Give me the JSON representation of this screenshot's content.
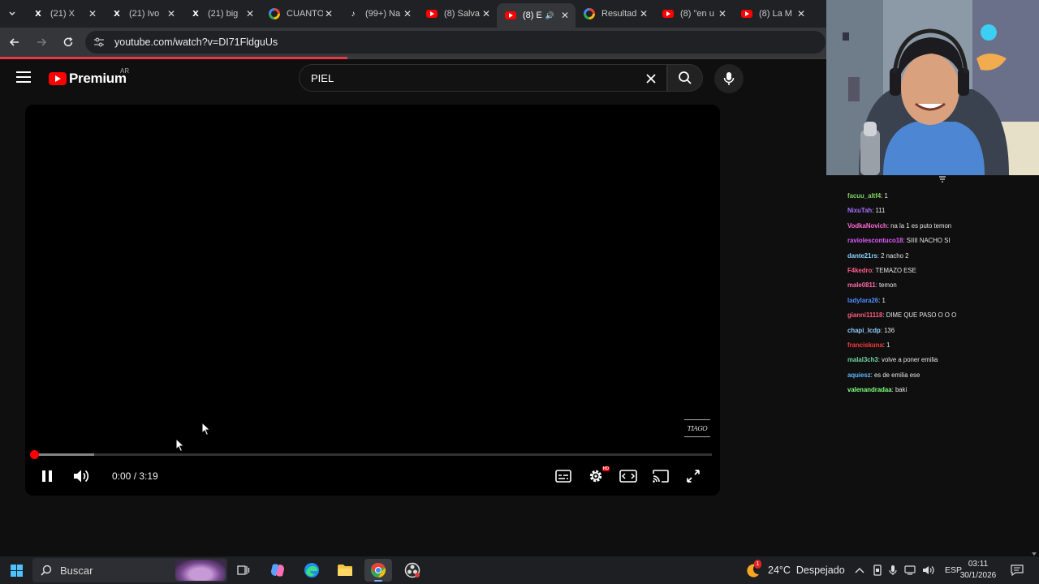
{
  "browser": {
    "tabs": [
      {
        "title": "(21) X",
        "icon": "x-logo-icon",
        "active": false
      },
      {
        "title": "(21) Ivo",
        "icon": "x-logo-icon",
        "active": false
      },
      {
        "title": "(21) big",
        "icon": "x-logo-icon",
        "active": false
      },
      {
        "title": "CUANTO",
        "icon": "google-icon",
        "active": false
      },
      {
        "title": "(99+) Na",
        "icon": "tiktok-icon",
        "active": false
      },
      {
        "title": "(8) Salva",
        "icon": "youtube-icon",
        "active": false
      },
      {
        "title": "(8) E",
        "icon": "youtube-icon",
        "active": true,
        "audio": true
      },
      {
        "title": "Resultad",
        "icon": "google-icon",
        "active": false
      },
      {
        "title": "(8) \"en u",
        "icon": "youtube-icon",
        "active": false
      },
      {
        "title": "(8) La M",
        "icon": "youtube-icon",
        "active": false
      }
    ],
    "url": "youtube.com/watch?v=DI71FldguUs",
    "load_progress_percent": 42
  },
  "youtube": {
    "logo_text": "Premium",
    "country_code": "AR",
    "search_query": "PIEL"
  },
  "player": {
    "watermark": "TIAGO",
    "current_time": "0:00",
    "separator": " / ",
    "duration": "3:19",
    "buffered_percent": 9,
    "played_percent": 0,
    "hd_badge": "HD"
  },
  "chat": {
    "messages": [
      {
        "user": "facuu_altf4",
        "color": "#7fd35f",
        "text": ": 1"
      },
      {
        "user": "NixuTah",
        "color": "#a970ff",
        "text": ": 111"
      },
      {
        "user": "VodkaNovich",
        "color": "#ff6ad5",
        "text": ": na la 1 es puto temon"
      },
      {
        "user": "raviolescontuco18",
        "color": "#e05cff",
        "text": ": SIIII NACHO SI"
      },
      {
        "user": "dante21rs",
        "color": "#8fd0ff",
        "text": ": 2 nacho 2"
      },
      {
        "user": "F4kedro",
        "color": "#ff5c8a",
        "text": ": TEMAZO ESE"
      },
      {
        "user": "male0811",
        "color": "#ff6aa8",
        "text": ": temon"
      },
      {
        "user": "ladylara26",
        "color": "#4f8cff",
        "text": ": 1"
      },
      {
        "user": "gianni11118",
        "color": "#ff5c7a",
        "text": ": DIME QUE PASO O O O"
      },
      {
        "user": "chapi_lcdp",
        "color": "#8fd0ff",
        "text": ": 136"
      },
      {
        "user": "franciskuna",
        "color": "#ff3b3b",
        "text": ": 1"
      },
      {
        "user": "malal3ch3",
        "color": "#6fd4a0",
        "text": ": volve a poner emilia"
      },
      {
        "user": "aquiesz",
        "color": "#5fb8ff",
        "text": ": es de emilia ese"
      },
      {
        "user": "valenandradaa",
        "color": "#7fff7f",
        "text": ": baki"
      }
    ]
  },
  "taskbar": {
    "search_placeholder": "Buscar",
    "weather": "24°C  Despejado",
    "language": "ESP",
    "time": "03:11",
    "date": "30/1/2026",
    "weather_badge": "1"
  }
}
